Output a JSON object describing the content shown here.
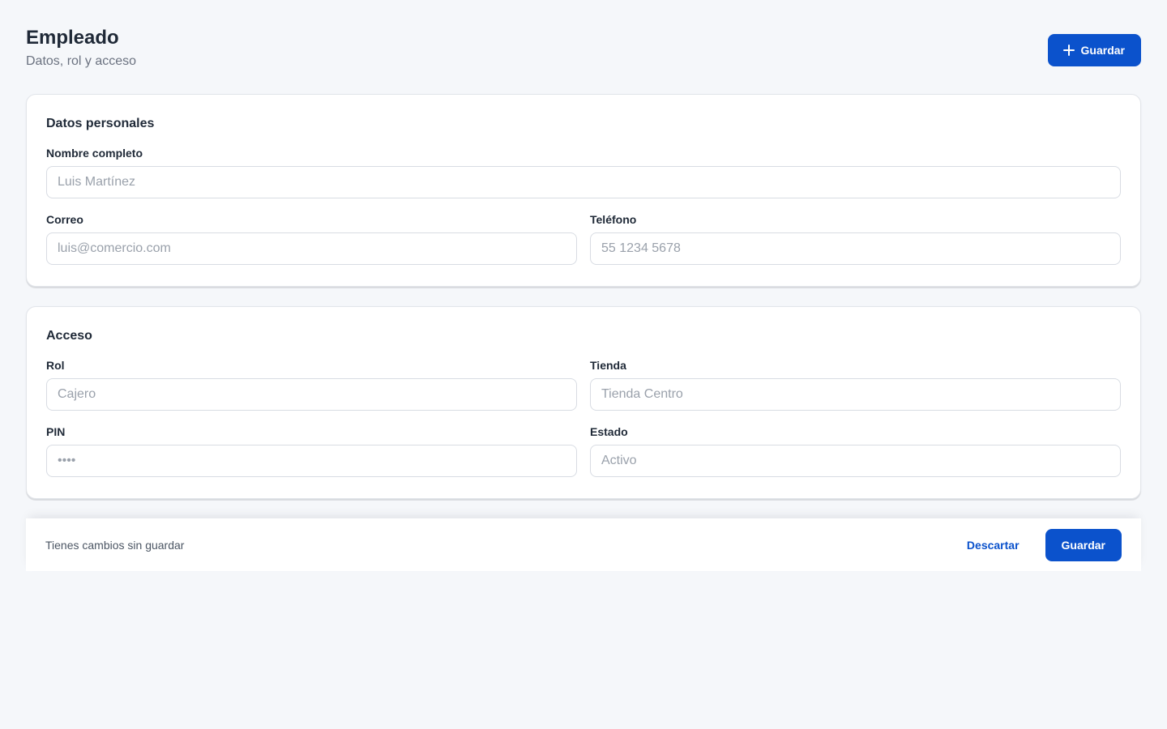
{
  "header": {
    "title": "Empleado",
    "subtitle": "Datos, rol y acceso",
    "save_label": "Guardar",
    "save_icon": "plus-icon"
  },
  "personal": {
    "title": "Datos personales",
    "name_label": "Nombre completo",
    "name_placeholder": "Luis Martínez",
    "email_label": "Correo",
    "email_placeholder": "luis@comercio.com",
    "phone_label": "Teléfono",
    "phone_placeholder": "55 1234 5678"
  },
  "access": {
    "title": "Acceso",
    "role_label": "Rol",
    "role_placeholder": "Cajero",
    "store_label": "Tienda",
    "store_placeholder": "Tienda Centro",
    "pin_label": "PIN",
    "pin_placeholder": "••••",
    "status_label": "Estado",
    "status_placeholder": "Activo"
  },
  "footer": {
    "message": "Tienes cambios sin guardar",
    "discard_label": "Descartar",
    "save_label": "Guardar"
  },
  "colors": {
    "accent": "#0b52cc",
    "background": "#f5f7fa"
  }
}
